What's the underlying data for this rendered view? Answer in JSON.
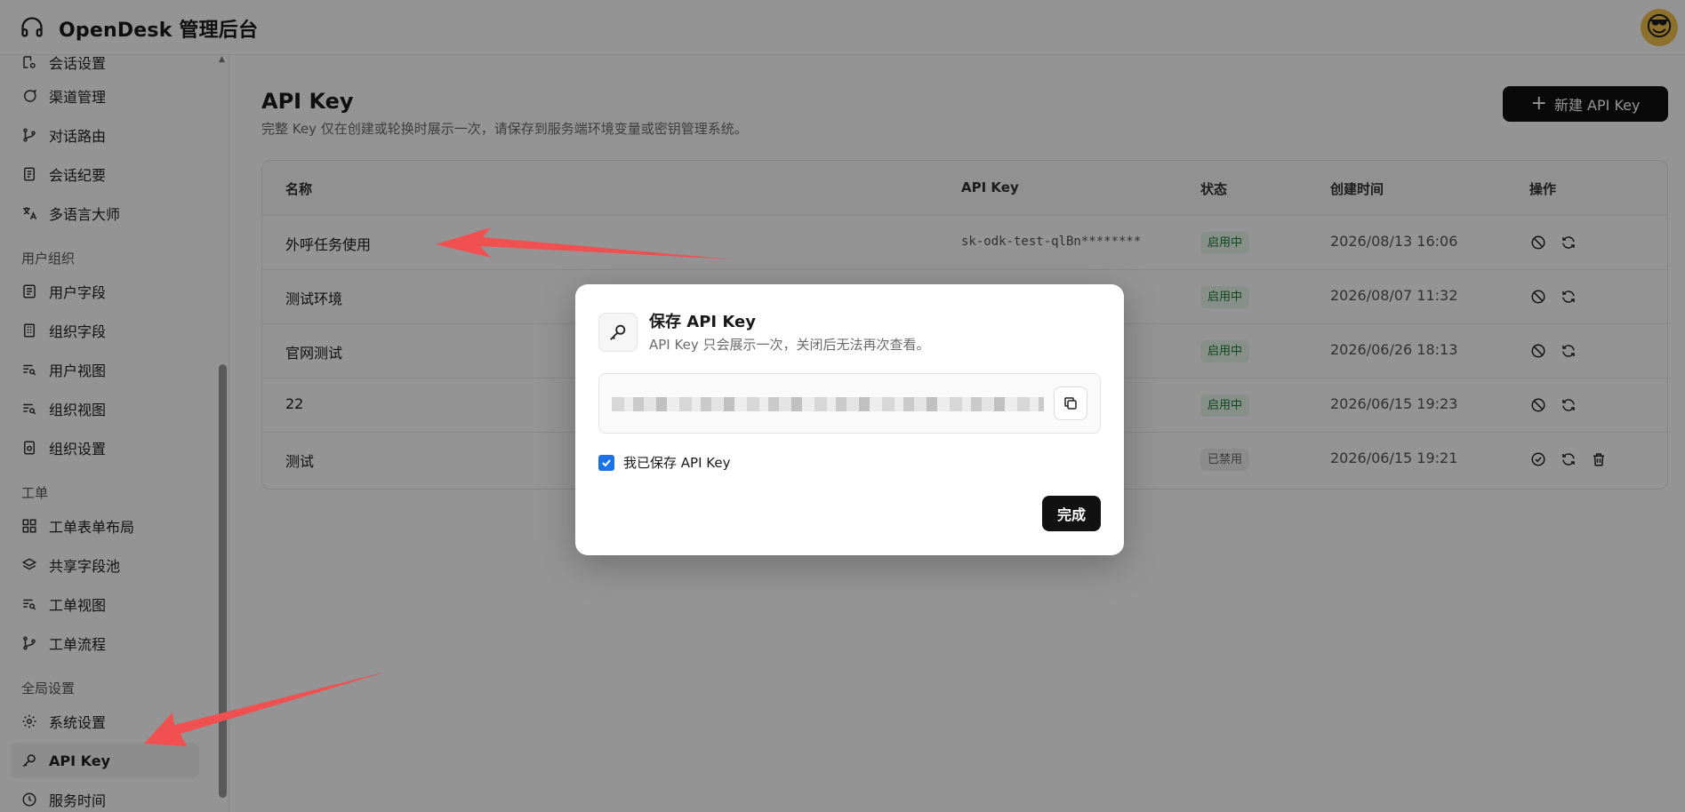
{
  "header": {
    "title": "OpenDesk 管理后台",
    "avatar": "😎"
  },
  "sidebar": {
    "items_top": [
      {
        "label": "会话设置",
        "icon": "session-settings-icon"
      },
      {
        "label": "渠道管理",
        "icon": "chat-bubble-icon"
      },
      {
        "label": "对话路由",
        "icon": "route-icon"
      },
      {
        "label": "会话纪要",
        "icon": "document-icon"
      },
      {
        "label": "多语言大师",
        "icon": "translate-icon"
      }
    ],
    "group_user": "用户组织",
    "items_user": [
      {
        "label": "用户字段",
        "icon": "field-icon"
      },
      {
        "label": "组织字段",
        "icon": "building-icon"
      },
      {
        "label": "用户视图",
        "icon": "list-search-icon"
      },
      {
        "label": "组织视图",
        "icon": "list-search-icon"
      },
      {
        "label": "组织设置",
        "icon": "settings-doc-icon"
      }
    ],
    "group_ticket": "工单",
    "items_ticket": [
      {
        "label": "工单表单布局",
        "icon": "grid-icon"
      },
      {
        "label": "共享字段池",
        "icon": "layers-icon"
      },
      {
        "label": "工单视图",
        "icon": "list-search-icon"
      },
      {
        "label": "工单流程",
        "icon": "route-icon"
      }
    ],
    "group_global": "全局设置",
    "items_global": [
      {
        "label": "系统设置",
        "icon": "gear-icon"
      },
      {
        "label": "API Key",
        "icon": "key-icon",
        "active": true
      },
      {
        "label": "服务时间",
        "icon": "clock-icon"
      }
    ]
  },
  "main": {
    "title": "API Key",
    "description": "完整 Key 仅在创建或轮换时展示一次，请保存到服务端环境变量或密钥管理系统。",
    "new_button": "新建 API Key",
    "table": {
      "headers": {
        "name": "名称",
        "key": "API Key",
        "status": "状态",
        "created": "创建时间",
        "actions": "操作"
      },
      "rows": [
        {
          "name": "外呼任务使用",
          "key": "sk-odk-test-qlBn********",
          "status": "启用中",
          "active": true,
          "created": "2026/08/13 16:06"
        },
        {
          "name": "测试环境",
          "key": "*",
          "status": "启用中",
          "active": true,
          "created": "2026/08/07 11:32"
        },
        {
          "name": "官网测试",
          "key": "*",
          "status": "启用中",
          "active": true,
          "created": "2026/06/26 18:13"
        },
        {
          "name": "22",
          "key": "*",
          "status": "启用中",
          "active": true,
          "created": "2026/06/15 19:23"
        },
        {
          "name": "测试",
          "key": "*",
          "status": "已禁用",
          "active": false,
          "created": "2026/06/15 19:21"
        }
      ]
    }
  },
  "modal": {
    "title": "保存 API Key",
    "description": "API Key 只会展示一次，关闭后无法再次查看。",
    "checkbox_label": "我已保存 API Key",
    "checkbox_checked": true,
    "done_button": "完成"
  },
  "colors": {
    "accent": "#111111",
    "active_badge_bg": "#e7f6ea",
    "active_badge_text": "#1b7a34",
    "arrow": "#f05050",
    "checkbox": "#1a73e8"
  }
}
